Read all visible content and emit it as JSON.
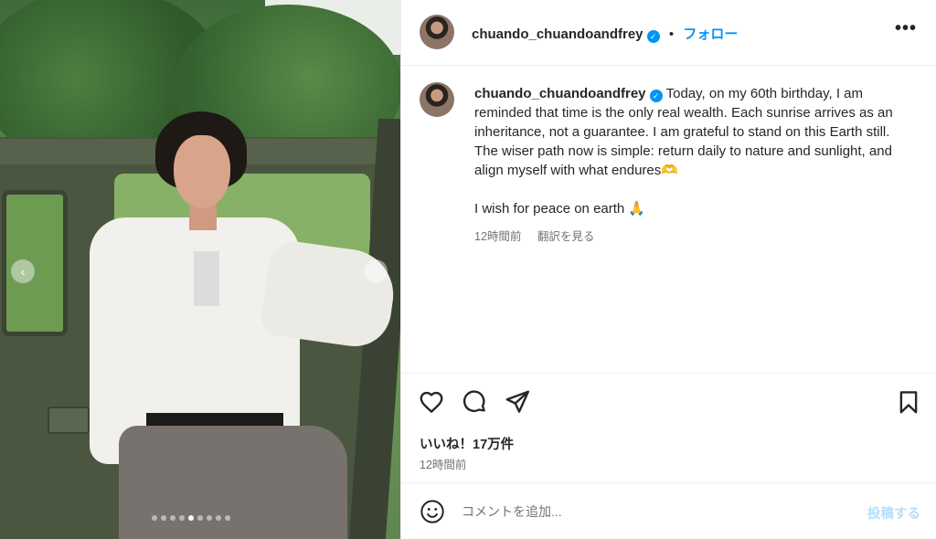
{
  "post": {
    "username": "chuando_chuandoandfrey",
    "verified_mark": "✓",
    "separator": "•",
    "follow_label": "フォロー",
    "more_label": "•••",
    "caption_line1": "Today, on my 60th birthday, I am reminded that time is the only real wealth. Each sunrise arrives as an inheritance, not a guarantee. I am grateful to stand on this Earth still. The wiser path now is simple: return daily to nature and sunlight, and align myself with what endures🫶",
    "caption_line2": "I wish for peace on earth 🙏",
    "caption_time": "12時間前",
    "translate_label": "翻訳を見る",
    "likes": "いいね！17万件",
    "post_time": "12時間前",
    "comment_placeholder": "コメントを追加...",
    "post_label": "投稿する"
  },
  "carousel": {
    "prev": "‹",
    "next": "›",
    "dot_count": 9,
    "active_index": 4
  },
  "icons": {
    "like": "heart-icon",
    "comment": "comment-icon",
    "share": "send-icon",
    "save": "bookmark-icon",
    "emoji": "emoji-icon"
  },
  "colors": {
    "accent": "#0095f6",
    "post_disabled": "#b2dffc",
    "muted": "#737373",
    "text": "#262626"
  }
}
